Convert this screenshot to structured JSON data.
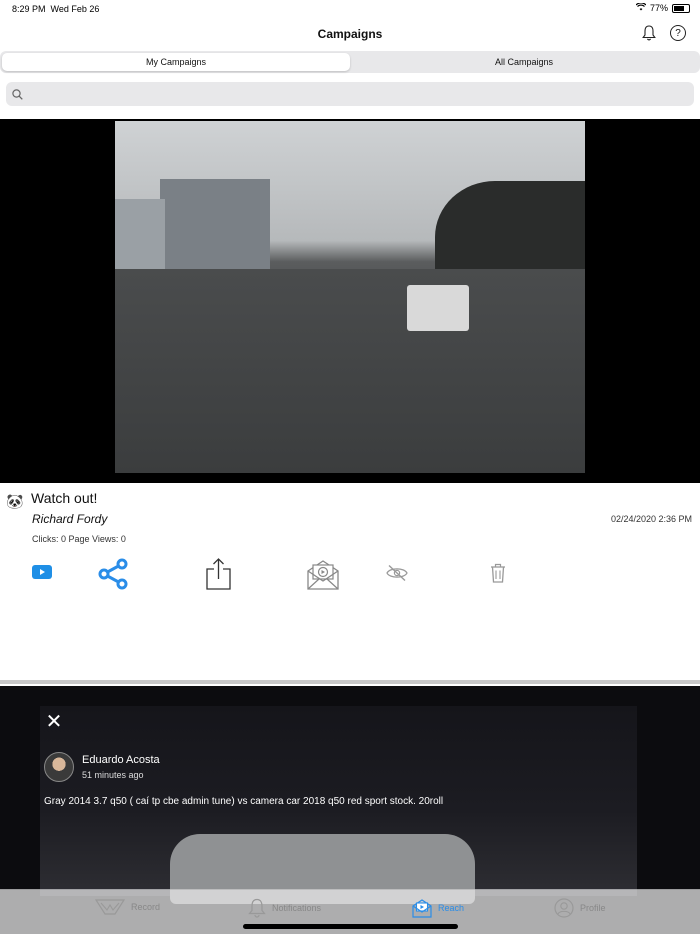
{
  "status_bar": {
    "time": "8:29 PM",
    "date": "Wed Feb 26",
    "battery": "77%",
    "battery_level": 0.77
  },
  "nav": {
    "title": "Campaigns",
    "bell_icon": "bell-icon",
    "help_icon": "help-icon",
    "help_label": "?"
  },
  "segments": [
    {
      "label": "My Campaigns",
      "active": true
    },
    {
      "label": "All Campaigns",
      "active": false
    }
  ],
  "search": {
    "placeholder": "",
    "value": ""
  },
  "campaign": {
    "title": "Watch out!",
    "author": "Richard Fordy",
    "date": "02/24/2020 2:36 PM",
    "stats": "Clicks: 0 Page Views: 0",
    "avatar": "🐼",
    "actions": [
      "youtube-icon",
      "share-nodes-icon",
      "export-icon",
      "email-video-icon",
      "hide-icon",
      "trash-icon"
    ]
  },
  "overlay": {
    "close": "✕",
    "poster_name": "Eduardo Acosta",
    "poster_time": "51 minutes ago",
    "caption": "Gray 2014 3.7 q50 ( caí tp cbe admin tune) vs camera car 2018 q50 red sport stock.  20roll"
  },
  "tabs": [
    {
      "label": "Record",
      "icon": "record-icon",
      "active": false
    },
    {
      "label": "Notifications",
      "icon": "bell-icon",
      "active": false
    },
    {
      "label": "Reach",
      "icon": "reach-icon",
      "active": true
    },
    {
      "label": "Profile",
      "icon": "profile-icon",
      "active": false
    }
  ],
  "colors": {
    "accent": "#2a8de8",
    "youtube": "#1f8fe6",
    "share": "#2a8de8"
  }
}
